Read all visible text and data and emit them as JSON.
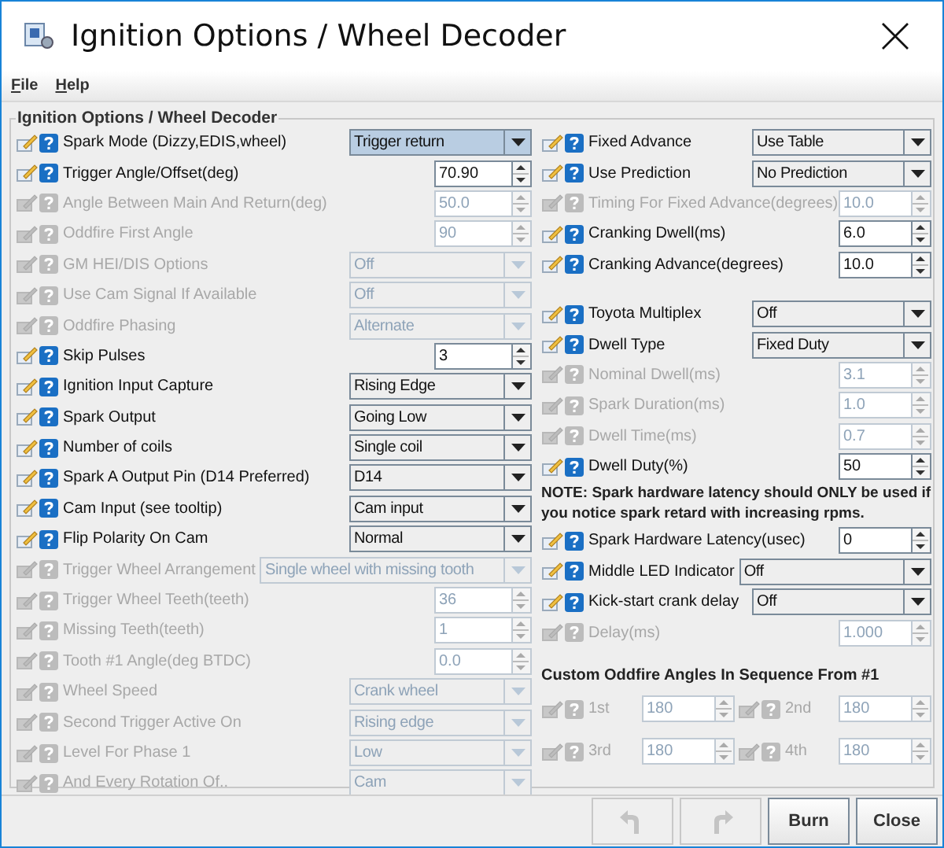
{
  "window": {
    "title": "Ignition Options / Wheel Decoder"
  },
  "menu": [
    {
      "label": "File"
    },
    {
      "label": "Help"
    }
  ],
  "panel": {
    "title": "Ignition Options / Wheel Decoder"
  },
  "left_rows": [
    {
      "kind": "combo",
      "label": "Spark Mode (Dizzy,EDIS,wheel)",
      "value": "Trigger return",
      "disabled": false,
      "focused": true
    },
    {
      "kind": "spinner",
      "label": "Trigger Angle/Offset(deg)",
      "value": "70.90",
      "disabled": false,
      "focused": false
    },
    {
      "kind": "spinner",
      "label": "Angle Between Main And Return(deg)",
      "value": "50.0",
      "disabled": true,
      "focused": false
    },
    {
      "kind": "spinner",
      "label": "Oddfire First Angle",
      "value": "90",
      "disabled": true,
      "focused": false
    },
    {
      "kind": "combo",
      "label": "GM HEI/DIS Options",
      "value": "Off",
      "disabled": true,
      "focused": false
    },
    {
      "kind": "combo",
      "label": "Use Cam Signal If Available",
      "value": "Off",
      "disabled": true,
      "focused": false
    },
    {
      "kind": "combo",
      "label": "Oddfire Phasing",
      "value": "Alternate",
      "disabled": true,
      "focused": false
    },
    {
      "kind": "spinner",
      "label": "Skip Pulses",
      "value": "3",
      "disabled": false,
      "focused": false
    },
    {
      "kind": "combo",
      "label": "Ignition Input Capture",
      "value": "Rising Edge",
      "disabled": false,
      "focused": false
    },
    {
      "kind": "combo",
      "label": "Spark Output",
      "value": "Going Low",
      "disabled": false,
      "focused": false
    },
    {
      "kind": "combo",
      "label": "Number of coils",
      "value": "Single coil",
      "disabled": false,
      "focused": false
    },
    {
      "kind": "combo",
      "label": "Spark A Output Pin (D14 Preferred)",
      "value": "D14",
      "disabled": false,
      "focused": false
    },
    {
      "kind": "combo",
      "label": "Cam Input (see tooltip)",
      "value": "Cam input",
      "disabled": false,
      "focused": false
    },
    {
      "kind": "combo",
      "label": "Flip Polarity On Cam",
      "value": "Normal",
      "disabled": false,
      "focused": false
    },
    {
      "kind": "wide_combo",
      "label": "Trigger Wheel Arrangement",
      "value": "Single wheel with missing tooth",
      "disabled": true,
      "focused": false
    },
    {
      "kind": "spinner",
      "label": "Trigger Wheel Teeth(teeth)",
      "value": "36",
      "disabled": true,
      "focused": false
    },
    {
      "kind": "spinner",
      "label": "Missing Teeth(teeth)",
      "value": "1",
      "disabled": true,
      "focused": false
    },
    {
      "kind": "spinner",
      "label": "Tooth #1 Angle(deg BTDC)",
      "value": "0.0",
      "disabled": true,
      "focused": false
    },
    {
      "kind": "combo",
      "label": "Wheel Speed",
      "value": "Crank wheel",
      "disabled": true,
      "focused": false
    },
    {
      "kind": "combo",
      "label": "Second Trigger Active On",
      "value": "Rising edge",
      "disabled": true,
      "focused": false
    },
    {
      "kind": "combo",
      "label": "Level For Phase 1",
      "value": "Low",
      "disabled": true,
      "focused": false
    },
    {
      "kind": "combo",
      "label": "And Every Rotation Of..",
      "value": "Cam",
      "disabled": true,
      "focused": false
    }
  ],
  "right_groups": [
    {
      "rows": [
        {
          "kind": "combo",
          "label": "Fixed Advance",
          "value": "Use Table",
          "disabled": false,
          "focused": false
        },
        {
          "kind": "combo",
          "label": "Use Prediction",
          "value": "No Prediction",
          "disabled": false,
          "focused": false
        },
        {
          "kind": "spinner",
          "label": "Timing For Fixed Advance(degrees)",
          "value": "10.0",
          "disabled": true,
          "focused": false
        },
        {
          "kind": "spinner",
          "label": "Cranking Dwell(ms)",
          "value": "6.0",
          "disabled": false,
          "focused": false
        },
        {
          "kind": "spinner",
          "label": "Cranking Advance(degrees)",
          "value": "10.0",
          "disabled": false,
          "focused": false
        }
      ]
    },
    {
      "rows": [
        {
          "kind": "combo",
          "label": "Toyota Multiplex",
          "value": "Off",
          "disabled": false,
          "focused": false
        },
        {
          "kind": "combo",
          "label": "Dwell Type",
          "value": "Fixed Duty",
          "disabled": false,
          "focused": false
        },
        {
          "kind": "spinner",
          "label": "Nominal Dwell(ms)",
          "value": "3.1",
          "disabled": true,
          "focused": false
        },
        {
          "kind": "spinner",
          "label": "Spark Duration(ms)",
          "value": "1.0",
          "disabled": true,
          "focused": false
        },
        {
          "kind": "spinner",
          "label": "Dwell Time(ms)",
          "value": "0.7",
          "disabled": true,
          "focused": false
        },
        {
          "kind": "spinner",
          "label": "Dwell Duty(%)",
          "value": "50",
          "disabled": false,
          "focused": false
        }
      ],
      "note": "NOTE: Spark hardware latency should ONLY be used if you notice spark retard with increasing rpms."
    },
    {
      "rows": [
        {
          "kind": "spinner",
          "label": "Spark Hardware Latency(usec)",
          "value": "0",
          "disabled": false,
          "focused": false
        },
        {
          "kind": "wide_combo",
          "label": "Middle LED Indicator",
          "value": "Off",
          "disabled": false,
          "focused": false
        },
        {
          "kind": "combo",
          "label": "Kick-start crank delay",
          "value": "Off",
          "disabled": false,
          "focused": false
        },
        {
          "kind": "spinner",
          "label": "Delay(ms)",
          "value": "1.000",
          "disabled": true,
          "focused": false
        }
      ]
    }
  ],
  "custom_angles": {
    "title": "Custom Oddfire Angles In Sequence From #1",
    "items": [
      {
        "label": "1st",
        "value": "180",
        "disabled": true
      },
      {
        "label": "2nd",
        "value": "180",
        "disabled": true
      },
      {
        "label": "3rd",
        "value": "180",
        "disabled": true
      },
      {
        "label": "4th",
        "value": "180",
        "disabled": true
      }
    ]
  },
  "buttons": [
    {
      "kind": "undo",
      "disabled": true
    },
    {
      "kind": "redo",
      "disabled": true
    },
    {
      "kind": "text",
      "label": "Burn",
      "disabled": false
    },
    {
      "kind": "text",
      "label": "Close",
      "disabled": false
    }
  ]
}
